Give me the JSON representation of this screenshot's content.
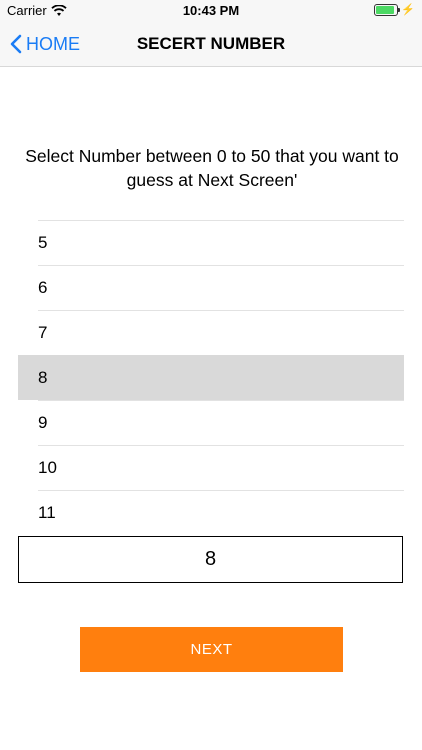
{
  "status": {
    "carrier": "Carrier",
    "time": "10:43 PM"
  },
  "nav": {
    "back_label": "HOME",
    "title": "SECERT NUMBER"
  },
  "instruction": "Select Number between 0 to 50 that you want to guess  at Next Screen'",
  "picker": {
    "items": [
      "5",
      "6",
      "7",
      "8",
      "9",
      "10",
      "11"
    ],
    "selected": "8"
  },
  "value": "8",
  "next_label": "NEXT",
  "colors": {
    "accent": "#1a7cf5",
    "button": "#ff7f0e",
    "selected_row": "#d9d9d9"
  }
}
